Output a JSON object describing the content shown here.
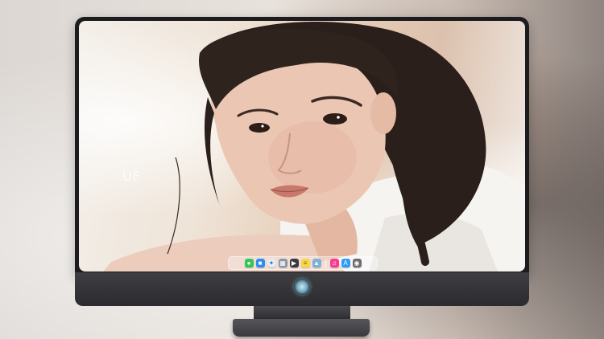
{
  "colors": {
    "bezel": "#1c1c1e",
    "chin": "#3e3e42",
    "wallpaper_warm": "#e7cdb7",
    "hair": "#2a1f1a",
    "skin": "#e9c4b0"
  },
  "wallpaper": {
    "subject": "photo of a young woman with dark hair in a white shirt",
    "watermark_text": "UF"
  },
  "dock": {
    "items": [
      {
        "name": "messages",
        "icon": "message-icon",
        "color": "#34c759"
      },
      {
        "name": "finder",
        "icon": "folder-icon",
        "color": "#2f8cf0"
      },
      {
        "name": "safari",
        "icon": "compass-icon",
        "color": "#e8eef5"
      },
      {
        "name": "launchpad",
        "icon": "grid-icon",
        "color": "#8a95a5"
      },
      {
        "name": "video-editor",
        "icon": "clapper-icon",
        "color": "#3a3a3c"
      },
      {
        "name": "notes",
        "icon": "notes-icon",
        "color": "#f7d74a"
      },
      {
        "name": "preview",
        "icon": "photo-icon",
        "color": "#7fb1d6"
      },
      {
        "name": "music",
        "icon": "music-icon",
        "color": "#fa3c8c"
      },
      {
        "name": "app-store",
        "icon": "appstore-icon",
        "color": "#2d9cf4"
      },
      {
        "name": "screenshot",
        "icon": "camera-icon",
        "color": "#6c6c70"
      }
    ]
  },
  "chin_logo": {
    "icon": "character-logo-icon"
  }
}
